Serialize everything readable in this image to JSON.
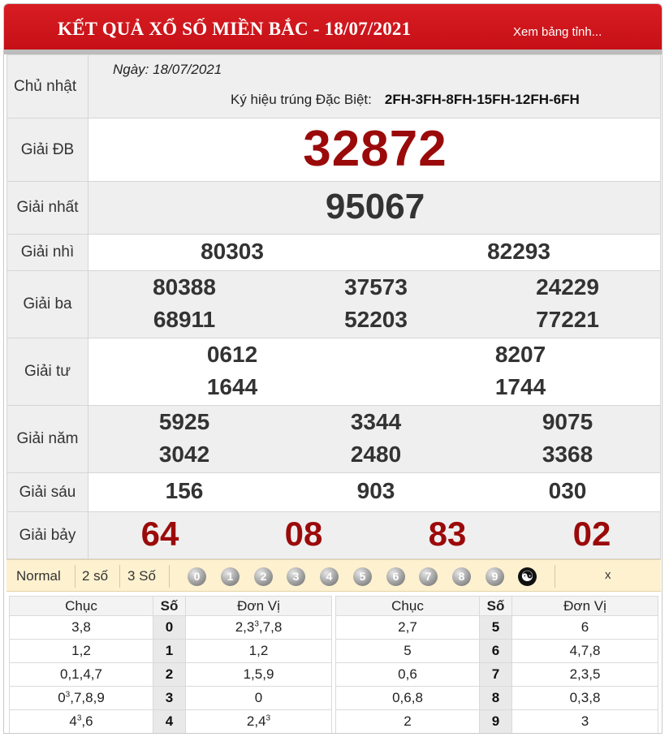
{
  "header": {
    "title": "KẾT QUẢ XỔ SỐ MIỀN BẮC - 18/07/2021",
    "link": "Xem bảng tỉnh..."
  },
  "info": {
    "day": "Chủ nhật",
    "date": "Ngày: 18/07/2021",
    "kyhieu_label": "Ký hiệu trúng Đặc Biệt:",
    "kyhieu_value": "2FH-3FH-8FH-15FH-12FH-6FH"
  },
  "prizes": {
    "db": {
      "label": "Giải ĐB",
      "numbers": [
        "32872"
      ]
    },
    "g1": {
      "label": "Giải nhất",
      "numbers": [
        "95067"
      ]
    },
    "g2": {
      "label": "Giải nhì",
      "numbers": [
        "80303",
        "82293"
      ]
    },
    "g3": {
      "label": "Giải ba",
      "numbers": [
        "80388",
        "37573",
        "24229",
        "68911",
        "52203",
        "77221"
      ]
    },
    "g4": {
      "label": "Giải tư",
      "numbers": [
        "0612",
        "8207",
        "1644",
        "1744"
      ]
    },
    "g5": {
      "label": "Giải năm",
      "numbers": [
        "5925",
        "3344",
        "9075",
        "3042",
        "2480",
        "3368"
      ]
    },
    "g6": {
      "label": "Giải sáu",
      "numbers": [
        "156",
        "903",
        "030"
      ]
    },
    "g7": {
      "label": "Giải bảy",
      "numbers": [
        "64",
        "08",
        "83",
        "02"
      ]
    }
  },
  "filter": {
    "options": [
      "Normal",
      "2 số",
      "3 Số"
    ],
    "digits": [
      "0",
      "1",
      "2",
      "3",
      "4",
      "5",
      "6",
      "7",
      "8",
      "9"
    ],
    "close": "x"
  },
  "loto": {
    "headers": {
      "chuc": "Chục",
      "so": "Số",
      "donvi": "Đơn Vị"
    },
    "left": [
      {
        "chuc": "3,8",
        "so": "0",
        "donvi": "2,3³,7,8"
      },
      {
        "chuc": "1,2",
        "so": "1",
        "donvi": "1,2"
      },
      {
        "chuc": "0,1,4,7",
        "so": "2",
        "donvi": "1,5,9"
      },
      {
        "chuc": "0³,7,8,9",
        "so": "3",
        "donvi": "0"
      },
      {
        "chuc": "4³,6",
        "so": "4",
        "donvi": "2,4³"
      }
    ],
    "right": [
      {
        "chuc": "2,7",
        "so": "5",
        "donvi": "6"
      },
      {
        "chuc": "5",
        "so": "6",
        "donvi": "4,7,8"
      },
      {
        "chuc": "0,6",
        "so": "7",
        "donvi": "2,3,5"
      },
      {
        "chuc": "0,6,8",
        "so": "8",
        "donvi": "0,3,8"
      },
      {
        "chuc": "2",
        "so": "9",
        "donvi": "3"
      }
    ]
  },
  "colors": {
    "header": "#c8141a",
    "special": "#9b0a0a",
    "filter_bg": "#fdf1cf"
  }
}
